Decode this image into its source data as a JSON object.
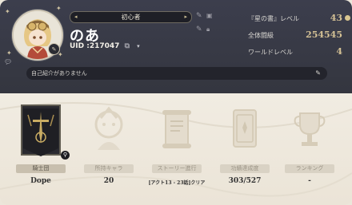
{
  "profile": {
    "title_badge": "初心者",
    "name": "のあ",
    "uid_label": "UID :",
    "uid_value": "217047",
    "bio": "自己紹介がありません"
  },
  "stats": [
    {
      "label": "『星の書』レベル",
      "value": "43"
    },
    {
      "label": "全体闘級",
      "value": "254545"
    },
    {
      "label": "ワールドレベル",
      "value": "4"
    }
  ],
  "tiles": [
    {
      "caption": "騎士団",
      "value": "Dope"
    },
    {
      "caption": "所持キャラ",
      "value": "20"
    },
    {
      "caption": "ストーリー進行",
      "value": "[アクト13 - 23話]クリア"
    },
    {
      "caption": "功績達成度",
      "value": "303/527"
    },
    {
      "caption": "ランキング",
      "value": "-"
    }
  ],
  "colors": {
    "header_bg": "#3c3e4d",
    "body_bg": "#ece6da",
    "gold": "#d4c195"
  },
  "icons": [
    "avatar",
    "pencil-icon",
    "copy-icon",
    "dropdown-arrow-icon",
    "edit-icon",
    "list-icon",
    "lock-icon",
    "chat-icon",
    "magnifier-icon",
    "guild-banner",
    "character-emblem",
    "scroll-emblem",
    "card-emblem",
    "trophy-emblem"
  ]
}
